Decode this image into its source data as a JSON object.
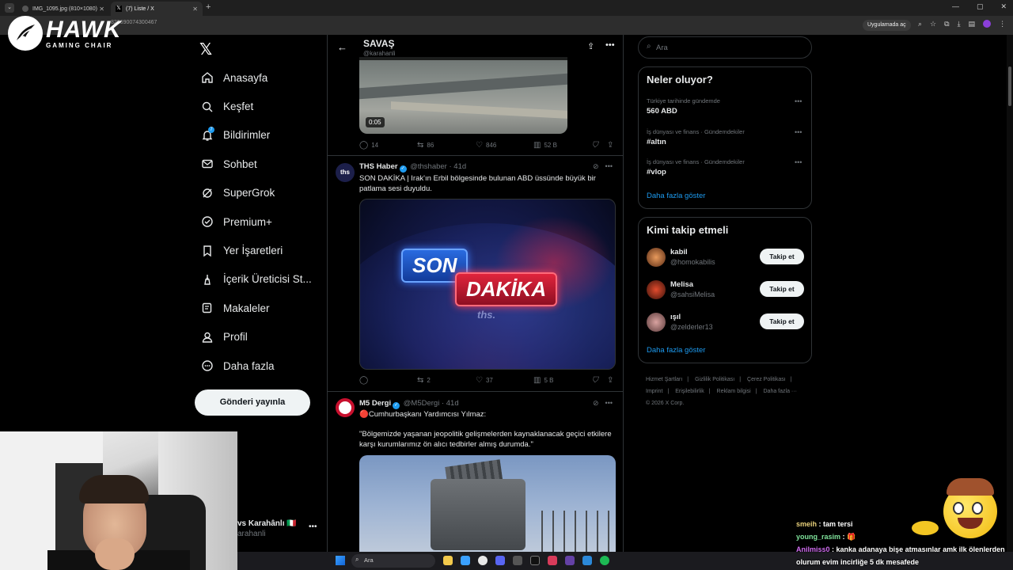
{
  "browser": {
    "tabs": [
      {
        "title": "IMG_1095.jpg (810×1080)"
      },
      {
        "title": "(7) Liste / X"
      }
    ],
    "url": "822690074300467",
    "open_in_app": "Uygulamada aç"
  },
  "overlay_logo": {
    "brand": "HAWK",
    "tagline": "GAMING CHAIR"
  },
  "nav": {
    "items": [
      {
        "label": "Anasayfa",
        "icon": "home-icon"
      },
      {
        "label": "Keşfet",
        "icon": "search-icon"
      },
      {
        "label": "Bildirimler",
        "icon": "bell-icon",
        "badge": "7"
      },
      {
        "label": "Sohbet",
        "icon": "mail-icon"
      },
      {
        "label": "SuperGrok",
        "icon": "grok-icon"
      },
      {
        "label": "Premium+",
        "icon": "verified-icon"
      },
      {
        "label": "Yer İşaretleri",
        "icon": "bookmark-icon"
      },
      {
        "label": "İçerik Üreticisi St...",
        "icon": "creator-studio-icon"
      },
      {
        "label": "Makaleler",
        "icon": "article-icon"
      },
      {
        "label": "Profil",
        "icon": "person-icon"
      },
      {
        "label": "Daha fazla",
        "icon": "more-circle-icon"
      }
    ],
    "post_button": "Gönderi yayınla",
    "account": {
      "name": "vs Karahânlı 🇮🇹",
      "handle": "arahanli"
    }
  },
  "feed": {
    "title": "SAVAŞ",
    "subtitle": "@karahanli",
    "video_time": "0:05",
    "tweet0_actions": {
      "replies": "14",
      "reposts": "86",
      "likes": "846",
      "views": "52 B"
    },
    "tweets": [
      {
        "name": "THS Haber",
        "handle": "@thshaber",
        "time": "· 41d",
        "text": "SON DAKİKA | Irak'ın Erbil bölgesinde bulunan ABD üssünde büyük bir patlama sesi duyuldu.",
        "image_son": "SON",
        "image_dakika": "DAKİKA",
        "image_brand": "ths.",
        "replies": "",
        "reposts": "2",
        "likes": "37",
        "views": "5 B"
      },
      {
        "name": "M5 Dergi",
        "handle": "@M5Dergi",
        "time": "· 41d",
        "text1": "🔴Cumhurbaşkanı Yardımcısı Yılmaz:",
        "text2": "\"Bölgemizde yaşanan jeopolitik gelişmelerden kaynaklanacak geçici etkilere karşı kurumlarımız ön alıcı tedbirler almış durumda.\""
      }
    ]
  },
  "right": {
    "search_placeholder": "Ara",
    "trends_title": "Neler oluyor?",
    "trends": [
      {
        "meta": "Türkiye tarihinde gündemde",
        "title": "560 ABD"
      },
      {
        "meta": "İş dünyası ve finans · Gündemdekiler",
        "title": "#altın"
      },
      {
        "meta": "İş dünyası ve finans · Gündemdekiler",
        "title": "#vlop"
      }
    ],
    "show_more": "Daha fazla göster",
    "follow_title": "Kimi takip etmeli",
    "follow": [
      {
        "name": "kabil",
        "handle": "@homokabilis",
        "button": "Takip et"
      },
      {
        "name": "Melisa",
        "handle": "@sahsiMelisa",
        "button": "Takip et"
      },
      {
        "name": "ışıl",
        "handle": "@zelderler13",
        "button": "Takip et"
      }
    ],
    "footer": [
      "Hizmet Şartları",
      "|",
      "Gizlilik Politikası",
      "|",
      "Çerez Politikası",
      "|",
      "Imprint",
      "|",
      "Erişilebilirlik",
      "|",
      "Reklam bilgisi",
      "|",
      "Daha fazla ···",
      "© 2026 X Corp."
    ]
  },
  "chat": [
    {
      "user": "smeih",
      "msg": ": tam tersi"
    },
    {
      "user": "young_rasim",
      "msg": ": 🎁"
    },
    {
      "user": "Anilmiss0",
      "msg": ": kanka adanaya bişe atmasınlar amk ilk ölenlerden olurum evim incirliğe 5 dk mesafede"
    }
  ],
  "taskbar": {
    "search": "Ara"
  }
}
